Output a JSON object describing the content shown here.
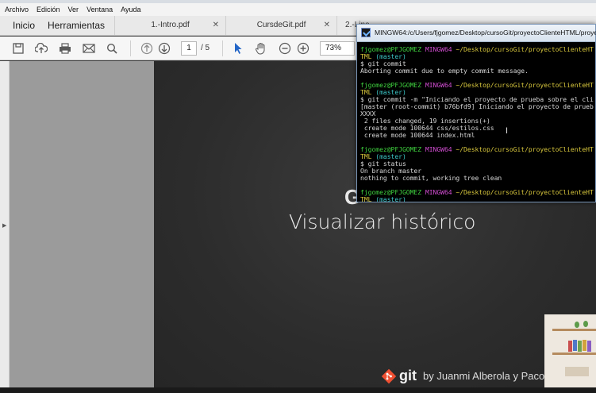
{
  "menu": [
    "Archivo",
    "Edición",
    "Ver",
    "Ventana",
    "Ayuda"
  ],
  "tabs": {
    "home": "Inicio",
    "tools": "Herramientas",
    "documents": [
      "1.-Intro.pdf",
      "CursdeGit.pdf",
      "2.-Line"
    ]
  },
  "toolbar": {
    "current_page": "1",
    "total_pages": "/ 5",
    "zoom": "73%"
  },
  "terminal": {
    "title": "MINGW64:/c/Users/fjgomez/Desktop/cursoGit/proyectoClienteHTML/proyec",
    "lines": [
      [
        {
          "t": "fjgomez@PFJGOMEZ ",
          "c": "g"
        },
        {
          "t": "MINGW64 ",
          "c": "m"
        },
        {
          "t": "~/Desktop/cursoGit/proyectoClienteHT",
          "c": "y"
        }
      ],
      [
        {
          "t": "TML ",
          "c": "y"
        },
        {
          "t": "(master)",
          "c": "c"
        }
      ],
      [
        {
          "t": "$ git commit",
          "c": "w"
        }
      ],
      [
        {
          "t": "Aborting commit due to empty commit message.",
          "c": "w"
        }
      ],
      [
        {
          "t": "",
          "c": "w"
        }
      ],
      [
        {
          "t": "fjgomez@PFJGOMEZ ",
          "c": "g"
        },
        {
          "t": "MINGW64 ",
          "c": "m"
        },
        {
          "t": "~/Desktop/cursoGit/proyectoClienteHT",
          "c": "y"
        }
      ],
      [
        {
          "t": "TML ",
          "c": "y"
        },
        {
          "t": "(master)",
          "c": "c"
        }
      ],
      [
        {
          "t": "$ git commit -m \"Iniciando el proyecto de prueba sobre el cli",
          "c": "w"
        }
      ],
      [
        {
          "t": "[master (root-commit) b76bfd9] Iniciando el proyecto de prueb",
          "c": "w"
        }
      ],
      [
        {
          "t": "XXXX",
          "c": "w"
        }
      ],
      [
        {
          "t": " 2 files changed, 19 insertions(+)",
          "c": "w"
        }
      ],
      [
        {
          "t": " create mode 100644 css/estilos.css",
          "c": "w"
        }
      ],
      [
        {
          "t": " create mode 100644 index.html",
          "c": "w"
        }
      ],
      [
        {
          "t": "",
          "c": "w"
        }
      ],
      [
        {
          "t": "fjgomez@PFJGOMEZ ",
          "c": "g"
        },
        {
          "t": "MINGW64 ",
          "c": "m"
        },
        {
          "t": "~/Desktop/cursoGit/proyectoClienteHT",
          "c": "y"
        }
      ],
      [
        {
          "t": "TML ",
          "c": "y"
        },
        {
          "t": "(master)",
          "c": "c"
        }
      ],
      [
        {
          "t": "$ git status",
          "c": "w"
        }
      ],
      [
        {
          "t": "On branch master",
          "c": "w"
        }
      ],
      [
        {
          "t": "nothing to commit, working tree clean",
          "c": "w"
        }
      ],
      [
        {
          "t": "",
          "c": "w"
        }
      ],
      [
        {
          "t": "fjgomez@PFJGOMEZ ",
          "c": "g"
        },
        {
          "t": "MINGW64 ",
          "c": "m"
        },
        {
          "t": "~/Desktop/cursoGit/proyectoClienteHT",
          "c": "y"
        }
      ],
      [
        {
          "t": "TML ",
          "c": "y"
        },
        {
          "t": "(master)",
          "c": "c"
        }
      ],
      [
        {
          "t": "$",
          "c": "w"
        }
      ]
    ]
  },
  "slide": {
    "heading": "G",
    "subtitle": "Visualizar histórico",
    "footer_brand": "git",
    "footer_byline": "by Juanmi Alberola y Paco"
  },
  "colors": {
    "prompt_user": "#3fd23f",
    "prompt_host": "#d14dd1",
    "prompt_path": "#d9c83d",
    "prompt_branch": "#3cc7c7",
    "git_brand": "#f05032"
  }
}
